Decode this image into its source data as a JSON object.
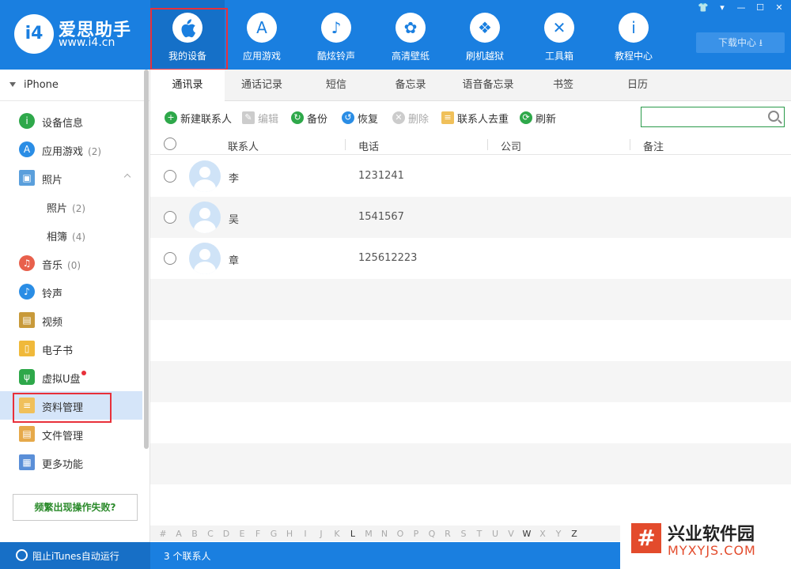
{
  "app": {
    "logo_mark": "i4",
    "logo_name": "爱思助手",
    "logo_url": "www.i4.cn",
    "download_label": "下载中心 ⭳"
  },
  "nav": [
    {
      "label": "我的设备",
      "icon": "apple-icon",
      "glyph": ""
    },
    {
      "label": "应用游戏",
      "icon": "app-store-icon",
      "glyph": "A"
    },
    {
      "label": "酷炫铃声",
      "icon": "bell-icon",
      "glyph": "♪"
    },
    {
      "label": "高清壁纸",
      "icon": "flower-icon",
      "glyph": "✿"
    },
    {
      "label": "刷机越狱",
      "icon": "box-icon",
      "glyph": "❖"
    },
    {
      "label": "工具箱",
      "icon": "tools-icon",
      "glyph": "✕"
    },
    {
      "label": "教程中心",
      "icon": "info-icon",
      "glyph": "i"
    }
  ],
  "window_controls": [
    "👕",
    "▾",
    "—",
    "☐",
    "✕"
  ],
  "sidebar": {
    "device": "iPhone",
    "items": [
      {
        "label": "设备信息",
        "count": "",
        "icon": "info-icon",
        "color": "#2ea84a",
        "glyph": "i"
      },
      {
        "label": "应用游戏",
        "count": "(2)",
        "icon": "app-store-icon",
        "color": "#2a8de5",
        "glyph": "A"
      },
      {
        "label": "照片",
        "count": "",
        "icon": "photo-icon",
        "color": "#5a9fdc",
        "glyph": "▣"
      },
      {
        "label": "照片",
        "count": "(2)",
        "icon": "",
        "color": "",
        "glyph": ""
      },
      {
        "label": "相簿",
        "count": "(4)",
        "icon": "",
        "color": "",
        "glyph": ""
      },
      {
        "label": "音乐",
        "count": "(0)",
        "icon": "music-icon",
        "color": "#e8604c",
        "glyph": "♫"
      },
      {
        "label": "铃声",
        "count": "",
        "icon": "bell-icon",
        "color": "#2a8de5",
        "glyph": "♪"
      },
      {
        "label": "视频",
        "count": "",
        "icon": "film-icon",
        "color": "#c89a3a",
        "glyph": "▤"
      },
      {
        "label": "电子书",
        "count": "",
        "icon": "book-icon",
        "color": "#f0b93a",
        "glyph": "▯"
      },
      {
        "label": "虚拟U盘",
        "count": "",
        "icon": "usb-icon",
        "color": "#2ea84a",
        "glyph": "ψ"
      },
      {
        "label": "资料管理",
        "count": "",
        "icon": "contacts-icon",
        "color": "#f0c05a",
        "glyph": "≡"
      },
      {
        "label": "文件管理",
        "count": "",
        "icon": "file-icon",
        "color": "#e6a94a",
        "glyph": "▤"
      },
      {
        "label": "更多功能",
        "count": "",
        "icon": "grid-icon",
        "color": "#5a8fd8",
        "glyph": "▦"
      }
    ],
    "fail_button": "频繁出现操作失败?"
  },
  "tabs": [
    "通讯录",
    "通话记录",
    "短信",
    "备忘录",
    "语音备忘录",
    "书签",
    "日历"
  ],
  "toolbar": {
    "new_contact": "新建联系人",
    "edit": "编辑",
    "backup": "备份",
    "restore": "恢复",
    "delete": "删除",
    "dedupe": "联系人去重",
    "refresh": "刷新",
    "search_value": ""
  },
  "table": {
    "headers": [
      "联系人",
      "电话",
      "公司",
      "备注"
    ],
    "rows": [
      {
        "name": "李",
        "phone": "1231241"
      },
      {
        "name": "吴",
        "phone": "1541567"
      },
      {
        "name": "章",
        "phone": "125612223"
      }
    ]
  },
  "alphabet": [
    "#",
    "A",
    "B",
    "C",
    "D",
    "E",
    "F",
    "G",
    "H",
    "I",
    "J",
    "K",
    "L",
    "M",
    "N",
    "O",
    "P",
    "Q",
    "R",
    "S",
    "T",
    "U",
    "V",
    "W",
    "X",
    "Y",
    "Z"
  ],
  "alphabet_active": [
    "L",
    "W",
    "Z"
  ],
  "status": {
    "itunes": "阻止iTunes自动运行",
    "count": "3 个联系人"
  },
  "watermark": {
    "mark": "#",
    "title": "兴业软件园",
    "sub": "MYXYJS.COM"
  }
}
